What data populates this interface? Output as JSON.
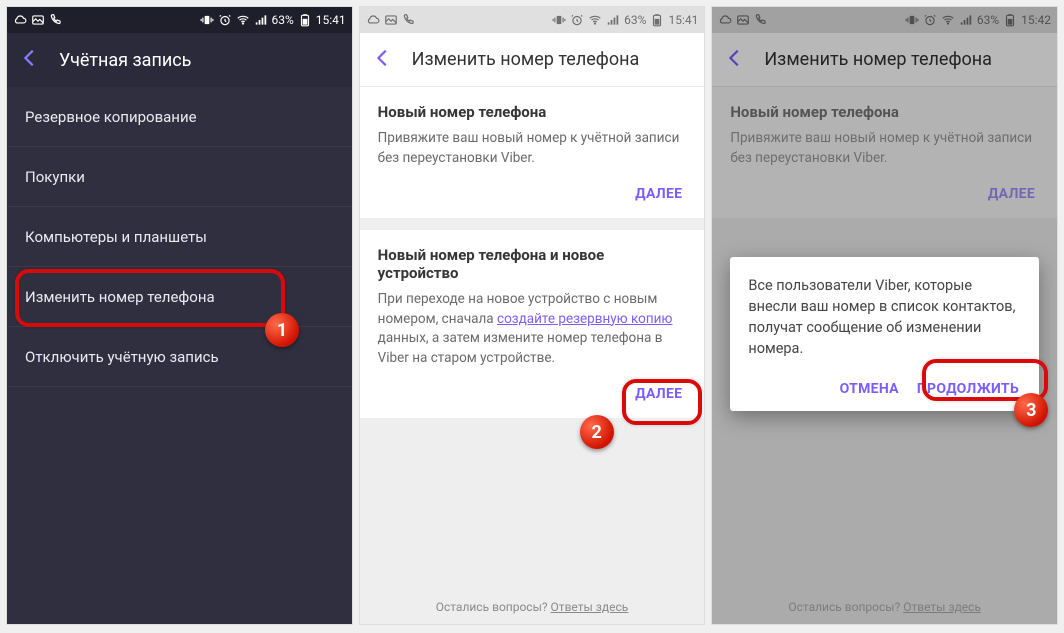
{
  "status": {
    "battery": "63%",
    "time1": "15:41",
    "time2": "15:41",
    "time3": "15:42"
  },
  "screen1": {
    "title": "Учётная запись",
    "items": [
      "Резервное копирование",
      "Покупки",
      "Компьютеры и планшеты",
      "Изменить номер телефона",
      "Отключить учётную запись"
    ]
  },
  "screen2": {
    "title": "Изменить номер телефона",
    "card1": {
      "title": "Новый номер телефона",
      "text": "Привяжите ваш новый номер к учётной записи без переустановки Viber.",
      "action": "ДАЛЕЕ"
    },
    "card2": {
      "title": "Новый номер телефона и новое устройство",
      "text_pre": "При переходе на новое устройство с новым номером, сначала ",
      "text_link": "создайте резервную копию",
      "text_post": " данных, а затем измените номер телефона в Viber на старом устройстве.",
      "action": "ДАЛЕЕ"
    },
    "footer_q": "Остались вопросы? ",
    "footer_link": "Ответы здесь"
  },
  "screen3": {
    "title": "Изменить номер телефона",
    "dialog": {
      "text": "Все пользователи Viber, которые внесли ваш номер в список контактов, получат сообщение об изменении номера.",
      "cancel": "ОТМЕНА",
      "continue": "ПРОДОЛЖИТЬ"
    }
  },
  "badges": {
    "b1": "1",
    "b2": "2",
    "b3": "3"
  }
}
